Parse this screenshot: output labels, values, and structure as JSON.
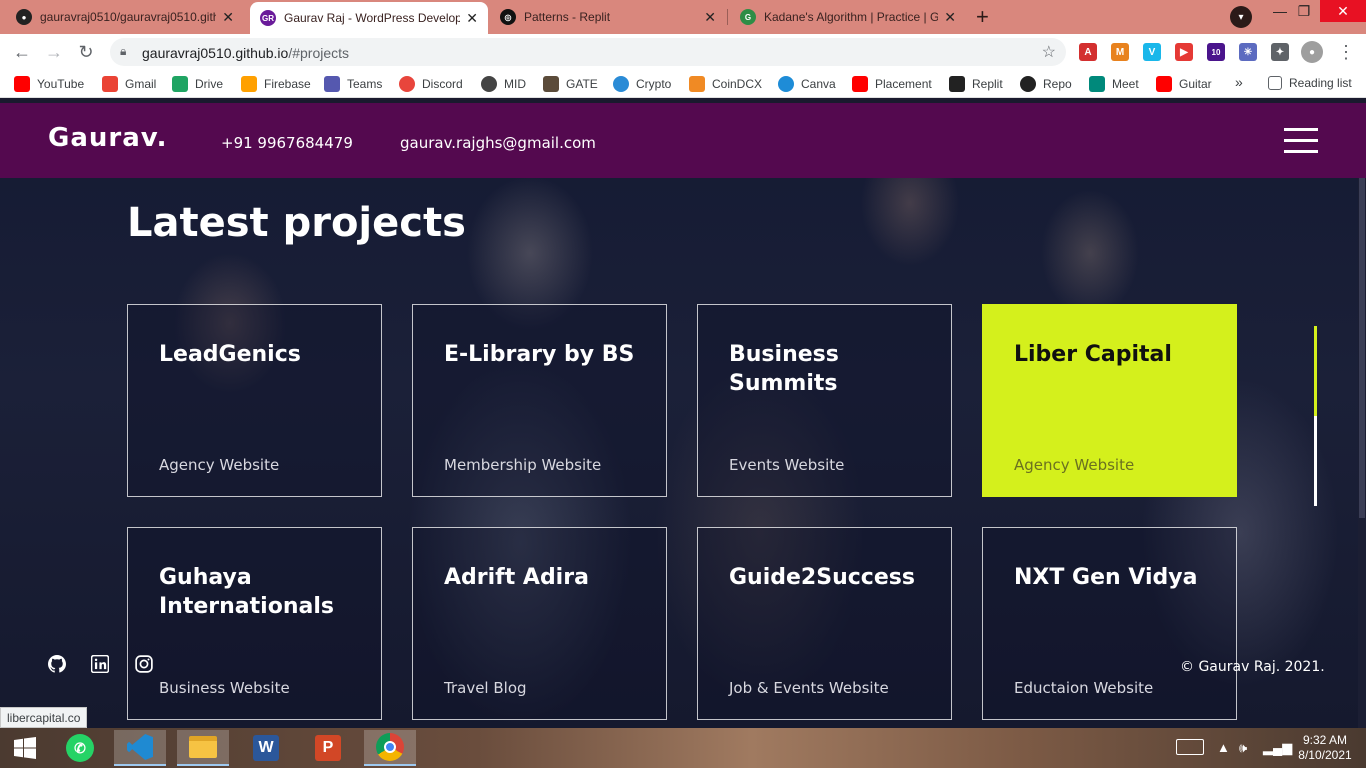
{
  "browser": {
    "tabs": [
      {
        "title": "gauravraj0510/gauravraj0510.gith",
        "close": "✕",
        "favicon": "github-icon"
      },
      {
        "title": "Gaurav Raj - WordPress Developer",
        "close": "✕",
        "favicon": "gr-logo-icon",
        "favicon_text": "GR"
      },
      {
        "title": "Patterns - Replit",
        "close": "✕",
        "favicon": "replit-icon"
      },
      {
        "title": "Kadane's Algorithm | Practice | Geeks",
        "close": "✕",
        "favicon": "gfg-icon"
      }
    ],
    "new_tab": "+",
    "window_controls": {
      "minimize": "—",
      "maximize": "❐",
      "close": "✕"
    },
    "nav": {
      "back": "←",
      "forward": "→",
      "reload": "↻"
    },
    "url_host": "gauravraj0510.github.io",
    "url_path": "/#projects",
    "star": "☆",
    "extension_badge": "10",
    "bookmarks": [
      {
        "label": "YouTube",
        "color": "#ff0000"
      },
      {
        "label": "Gmail",
        "color": "#ea4335"
      },
      {
        "label": "Drive",
        "color": "#1fa463"
      },
      {
        "label": "Firebase",
        "color": "#ffa000"
      },
      {
        "label": "Teams",
        "color": "#5558af"
      },
      {
        "label": "Discord",
        "color": "#e8453c"
      },
      {
        "label": "MID",
        "color": "#444444"
      },
      {
        "label": "GATE",
        "color": "#5b4b3a"
      },
      {
        "label": "Crypto",
        "color": "#2a8bd6"
      },
      {
        "label": "CoinDCX",
        "color": "#f08a24"
      },
      {
        "label": "Canva",
        "color": "#1e8cd7"
      },
      {
        "label": "Placement",
        "color": "#ff0000"
      },
      {
        "label": "Replit",
        "color": "#222222"
      },
      {
        "label": "Repo",
        "color": "#222222"
      },
      {
        "label": "Meet",
        "color": "#00897b"
      },
      {
        "label": "Guitar",
        "color": "#ff0000"
      }
    ],
    "bookmarks_more": "»",
    "reading_list": "Reading list",
    "status_url": "libercapital.co"
  },
  "site": {
    "logo": "Gaurav.",
    "phone": "+91 9967684479",
    "email": "gaurav.rajghs@gmail.com",
    "section_title": "Latest projects",
    "projects": [
      {
        "title": "LeadGenics",
        "subtitle": "Agency Website"
      },
      {
        "title": "E-Library by BS",
        "subtitle": "Membership Website"
      },
      {
        "title": "Business Summits",
        "subtitle": "Events Website"
      },
      {
        "title": "Liber Capital",
        "subtitle": "Agency Website"
      },
      {
        "title": "Guhaya Internationals",
        "subtitle": "Business Website"
      },
      {
        "title": "Adrift Adira",
        "subtitle": "Travel Blog"
      },
      {
        "title": "Guide2Success",
        "subtitle": "Job & Events Website"
      },
      {
        "title": "NXT Gen Vidya",
        "subtitle": "Eductaion Website"
      }
    ],
    "copyright": "© Gaurav Raj. 2021.",
    "accent_color": "#d4f01c",
    "header_color": "#54094f"
  },
  "taskbar": {
    "apps": [
      "start",
      "whatsapp",
      "vscode",
      "file-explorer",
      "word",
      "powerpoint",
      "chrome"
    ],
    "time": "9:32 AM",
    "date": "8/10/2021"
  }
}
